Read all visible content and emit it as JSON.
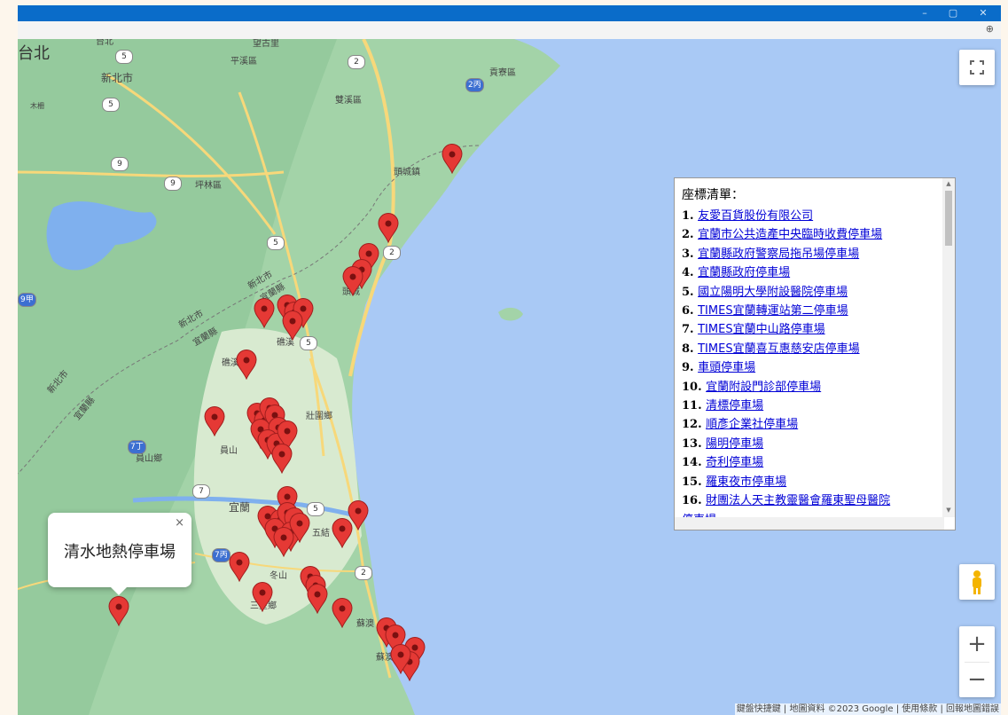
{
  "window": {
    "minimize": "–",
    "restore": "▢",
    "close": "✕"
  },
  "toolbar": {
    "zoom_icon": "magnifier-icon",
    "zoom_glyph": "⊕"
  },
  "map": {
    "labels": {
      "taipei": "台北",
      "taipei_small": "台北",
      "wanli": "望古里",
      "pingxi": "平溪區",
      "gongliao": "貢寮區",
      "xinbei": "新北市",
      "shuangxi": "雙溪區",
      "pinglin": "坪林區",
      "toucheng_town": "頭城鎮",
      "xinbei2": "新北市",
      "yilan_county": "宜蘭縣",
      "xinbei3": "新北市",
      "yilan_county2": "宜蘭縣",
      "xinbei4": "新北市",
      "yilan_county3": "宜蘭縣",
      "toucheng": "頭城",
      "jiaoxi": "礁溪",
      "jiaoxi2": "礁溪",
      "zhuangwei": "壯圍鄉",
      "yuanshan": "員山",
      "yuanshan_town": "員山鄉",
      "yilan": "宜蘭",
      "wujie": "五結",
      "dongshan": "冬山",
      "sanxing": "三星鄉",
      "suao": "蘇澳",
      "suao2": "蘇澳",
      "mu": "木柵"
    },
    "route_labels": [
      "5",
      "2",
      "2丙",
      "5",
      "9",
      "9",
      "5",
      "2",
      "5",
      "7丁",
      "7",
      "5",
      "7丙",
      "2",
      "9甲"
    ],
    "info_window": {
      "title": "清水地熱停車場",
      "close": "×"
    },
    "attribution": "鍵盤快捷鍵 | 地圖資料 ©2023 Google | 使用條款 | 回報地圖錯誤"
  },
  "controls": {
    "fullscreen_icon": "fullscreen-icon",
    "pegman_icon": "pegman-icon",
    "zoom_in": "+",
    "zoom_out": "−"
  },
  "list": {
    "heading": "座標清單：",
    "items": [
      {
        "num": "1.",
        "name": "友愛百貨股份有限公司"
      },
      {
        "num": "2.",
        "name": "宜蘭市公共造產中央臨時收費停車場"
      },
      {
        "num": "3.",
        "name": "宜蘭縣政府警察局拖吊場停車場"
      },
      {
        "num": "4.",
        "name": "宜蘭縣政府停車場"
      },
      {
        "num": "5.",
        "name": "國立陽明大學附設醫院停車場"
      },
      {
        "num": "6.",
        "name": "TIMES宜蘭轉運站第二停車場"
      },
      {
        "num": "7.",
        "name": "TIMES宜蘭中山路停車場"
      },
      {
        "num": "8.",
        "name": "TIMES宜蘭喜互惠慈安店停車場"
      },
      {
        "num": "9.",
        "name": "車頭停車場"
      },
      {
        "num": "10.",
        "name": "宜蘭附設門診部停車場"
      },
      {
        "num": "11.",
        "name": "清標停車場"
      },
      {
        "num": "12.",
        "name": "順彥企業社停車場"
      },
      {
        "num": "13.",
        "name": "陽明停車場"
      },
      {
        "num": "14.",
        "name": "奇利停車場"
      },
      {
        "num": "15.",
        "name": "羅東夜市停車場"
      },
      {
        "num": "16.",
        "name": "財團法人天主教靈醫會羅東聖母醫院"
      },
      {
        "num": "",
        "name": "停車場"
      }
    ]
  },
  "colors": {
    "land": "#9fd0a6",
    "sea": "#a9c9f5",
    "pin": "#e53935",
    "link": "#0000d6",
    "titlebar": "#0a6cc9"
  }
}
